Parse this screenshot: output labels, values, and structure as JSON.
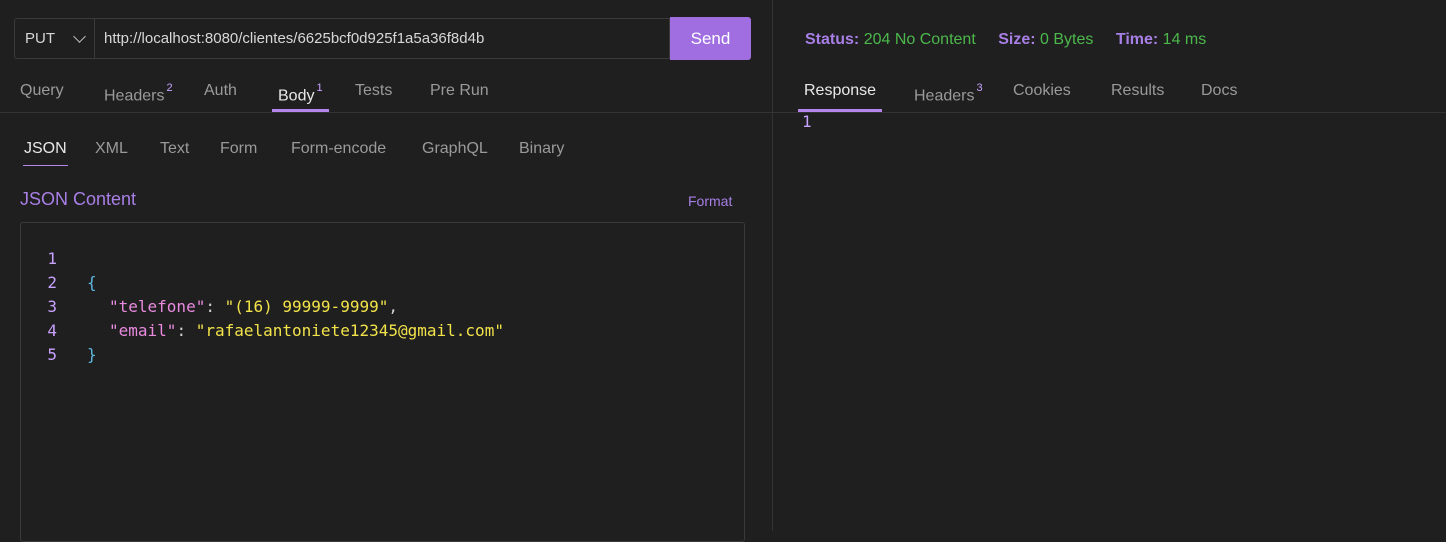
{
  "request": {
    "method": "PUT",
    "url": "http://localhost:8080/clientes/6625bcf0d925f1a5a36f8d4b",
    "send_label": "Send"
  },
  "request_tabs": [
    {
      "label": "Query",
      "badge": ""
    },
    {
      "label": "Headers",
      "badge": "2"
    },
    {
      "label": "Auth",
      "badge": ""
    },
    {
      "label": "Body",
      "badge": "1"
    },
    {
      "label": "Tests",
      "badge": ""
    },
    {
      "label": "Pre Run",
      "badge": ""
    }
  ],
  "body_types": [
    "JSON",
    "XML",
    "Text",
    "Form",
    "Form-encode",
    "GraphQL",
    "Binary"
  ],
  "json_content_title": "JSON Content",
  "format_label": "Format",
  "editor": {
    "line_numbers": [
      "1",
      "2",
      "3",
      "4",
      "5"
    ],
    "open_brace": "{",
    "close_brace": "}",
    "fields": [
      {
        "key": "\"telefone\"",
        "sep": ": ",
        "value": "\"(16) 99999-9999\"",
        "trail": ","
      },
      {
        "key": "\"email\"",
        "sep": ": ",
        "value": "\"rafaelantoniete12345@gmail.com\"",
        "trail": ""
      }
    ]
  },
  "response": {
    "status_label": "Status:",
    "status_value": "204 No Content",
    "size_label": "Size:",
    "size_value": "0 Bytes",
    "time_label": "Time:",
    "time_value": "14 ms",
    "tabs": [
      {
        "label": "Response",
        "badge": ""
      },
      {
        "label": "Headers",
        "badge": "3"
      },
      {
        "label": "Cookies",
        "badge": ""
      },
      {
        "label": "Results",
        "badge": ""
      },
      {
        "label": "Docs",
        "badge": ""
      }
    ],
    "line_number": "1"
  },
  "colors": {
    "accent": "#a06ee0",
    "status_ok": "#4cb84c",
    "background": "#1f1f1f"
  }
}
